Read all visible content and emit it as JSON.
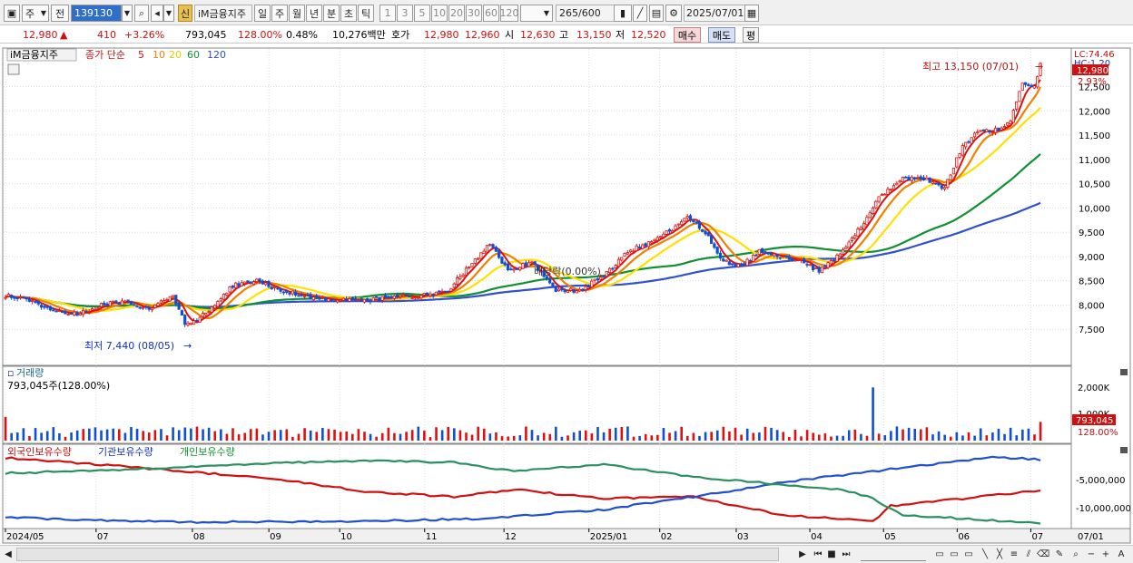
{
  "toolbar": {
    "market": "주",
    "mode": "전",
    "code": "139130",
    "credit": "신",
    "name": "iM금융지주",
    "periods": [
      "일",
      "주",
      "월",
      "년",
      "분",
      "초",
      "틱"
    ],
    "active_period": "일",
    "intervals": [
      "1",
      "3",
      "5",
      "10",
      "20",
      "30",
      "60",
      "120"
    ],
    "count": "265",
    "count_max": "/600",
    "date": "2025/07/01"
  },
  "quote": {
    "price": "12,980",
    "change": "410",
    "change_pct": "+3.26%",
    "volume": "793,045",
    "volume_ratio": "128.00%",
    "turnover": "0.48%",
    "amount": "10,276백만",
    "ask_label": "호가",
    "ask": "12,980",
    "bid": "12,960",
    "open_label": "시",
    "open": "12,630",
    "high_label": "고",
    "high": "13,150",
    "low_label": "저",
    "low": "12,520",
    "buy_label": "매수",
    "sell_label": "매도",
    "avg_label": "평"
  },
  "price_panel": {
    "legend_name": "iM금융지주",
    "legend_ma": "종가 단순",
    "ma_periods": [
      "5",
      "10",
      "20",
      "60",
      "120"
    ],
    "ma_colors": [
      "#e01010",
      "#f08000",
      "#ffe000",
      "#109030",
      "#3050d0"
    ],
    "high_annotation": "최고 13,150 (07/01)",
    "low_annotation": "최저 7,440 (08/05)",
    "dividend_annotation": "배당락(0.00%)",
    "lc_label": "LC:74.46",
    "hc_label": "HC:1.20",
    "price_tag": "12,980",
    "pct_tag": "2.93%"
  },
  "volume_panel": {
    "title": "거래량",
    "value": "793,045주(128.00%)",
    "axis_label": "2,000K",
    "axis_label2": "1,000K",
    "tag": "793,045",
    "pct_tag": "128.00%"
  },
  "holding_panel": {
    "series": [
      "외국인보유수량",
      "기관보유수량",
      "개인보유수량"
    ],
    "axis": [
      "-5,000,000",
      "-10,000,000"
    ]
  },
  "x_axis": [
    "2024/05",
    "07",
    "08",
    "09",
    "10",
    "11",
    "12",
    "2025/01",
    "02",
    "03",
    "04",
    "05",
    "06",
    "07"
  ],
  "x_axis_right": "07/01",
  "chart_data": {
    "type": "line",
    "title": "iM금융지주",
    "y_axis": [
      "12,500",
      "12,000",
      "11,500",
      "11,000",
      "10,500",
      "10,000",
      "9,500",
      "9,000",
      "8,500",
      "8,000",
      "7,500"
    ],
    "ylim": [
      7000,
      13200
    ],
    "close_waypoints": [
      [
        0,
        8200
      ],
      [
        8,
        8100
      ],
      [
        16,
        7900
      ],
      [
        24,
        7800
      ],
      [
        32,
        8000
      ],
      [
        40,
        8100
      ],
      [
        48,
        7900
      ],
      [
        56,
        8200
      ],
      [
        60,
        7600
      ],
      [
        64,
        7700
      ],
      [
        70,
        8000
      ],
      [
        76,
        8400
      ],
      [
        84,
        8500
      ],
      [
        92,
        8300
      ],
      [
        100,
        8200
      ],
      [
        110,
        8100
      ],
      [
        120,
        8100
      ],
      [
        130,
        8150
      ],
      [
        140,
        8200
      ],
      [
        148,
        8300
      ],
      [
        155,
        8800
      ],
      [
        162,
        9250
      ],
      [
        168,
        8700
      ],
      [
        176,
        8900
      ],
      [
        184,
        8300
      ],
      [
        192,
        8300
      ],
      [
        200,
        8600
      ],
      [
        208,
        9100
      ],
      [
        216,
        9300
      ],
      [
        224,
        9600
      ],
      [
        228,
        9800
      ],
      [
        234,
        9500
      ],
      [
        240,
        8900
      ],
      [
        246,
        8800
      ],
      [
        252,
        9100
      ],
      [
        258,
        9000
      ],
      [
        266,
        8900
      ],
      [
        272,
        8700
      ],
      [
        278,
        9000
      ],
      [
        286,
        9600
      ],
      [
        292,
        10200
      ],
      [
        300,
        10600
      ],
      [
        308,
        10600
      ],
      [
        314,
        10400
      ],
      [
        320,
        11300
      ],
      [
        326,
        11600
      ],
      [
        332,
        11600
      ],
      [
        336,
        11800
      ],
      [
        340,
        12600
      ],
      [
        344,
        12500
      ],
      [
        346,
        12980
      ]
    ],
    "n_days": 347,
    "volume_spikes": [
      [
        290,
        2.25
      ],
      [
        329,
        1.55
      ],
      [
        161,
        1.5
      ],
      [
        0,
        1.0
      ]
    ],
    "last_volume_ratio": 0.79
  }
}
